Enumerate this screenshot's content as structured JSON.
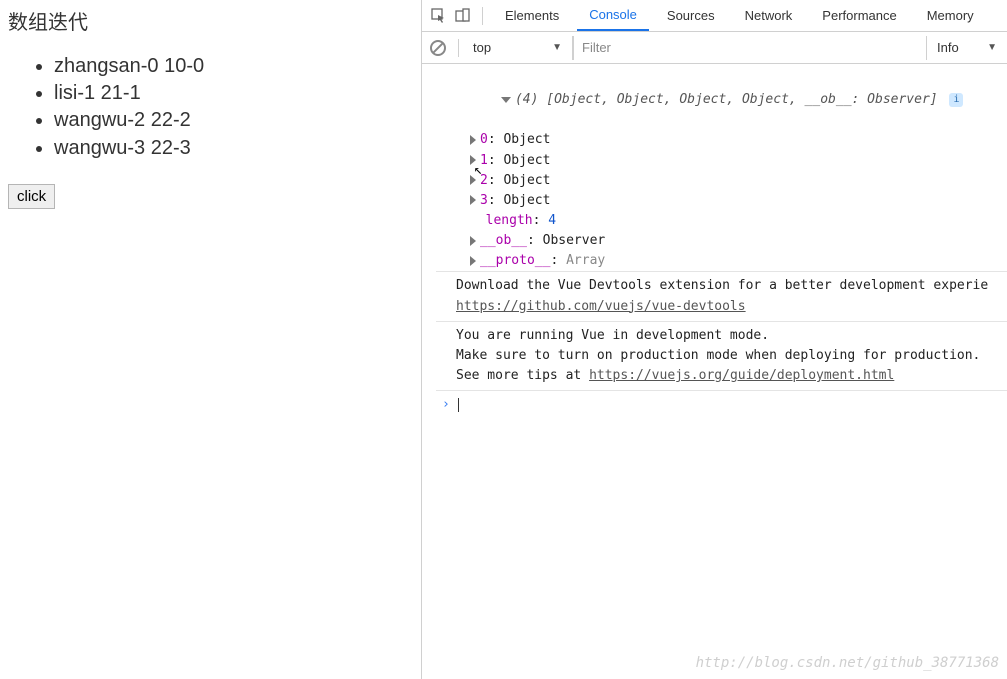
{
  "page": {
    "title": "数组迭代",
    "items": [
      "zhangsan-0 10-0",
      "lisi-1 21-1",
      "wangwu-2 22-2",
      "wangwu-3 22-3"
    ],
    "button_label": "click"
  },
  "devtools": {
    "tabs": [
      "Elements",
      "Console",
      "Sources",
      "Network",
      "Performance",
      "Memory"
    ],
    "active_tab": "Console",
    "context": "top",
    "filter_placeholder": "Filter",
    "level": "Info"
  },
  "console": {
    "summary_count": "(4)",
    "summary_body": "[Object, Object, Object, Object, __ob__: Observer]",
    "entries": [
      {
        "key": "0",
        "value": "Object"
      },
      {
        "key": "1",
        "value": "Object"
      },
      {
        "key": "2",
        "value": "Object"
      },
      {
        "key": "3",
        "value": "Object"
      }
    ],
    "length_key": "length",
    "length_value": "4",
    "ob_key": "__ob__",
    "ob_value": "Observer",
    "proto_key": "__proto__",
    "proto_value": "Array",
    "msg1_line1": "Download the Vue Devtools extension for a better development experie",
    "msg1_link": "https://github.com/vuejs/vue-devtools",
    "msg2_line1": "You are running Vue in development mode.",
    "msg2_line2": "Make sure to turn on production mode when deploying for production.",
    "msg2_line3a": "See more tips at ",
    "msg2_link": "https://vuejs.org/guide/deployment.html",
    "prompt": "›"
  },
  "watermark": "http://blog.csdn.net/github_38771368"
}
